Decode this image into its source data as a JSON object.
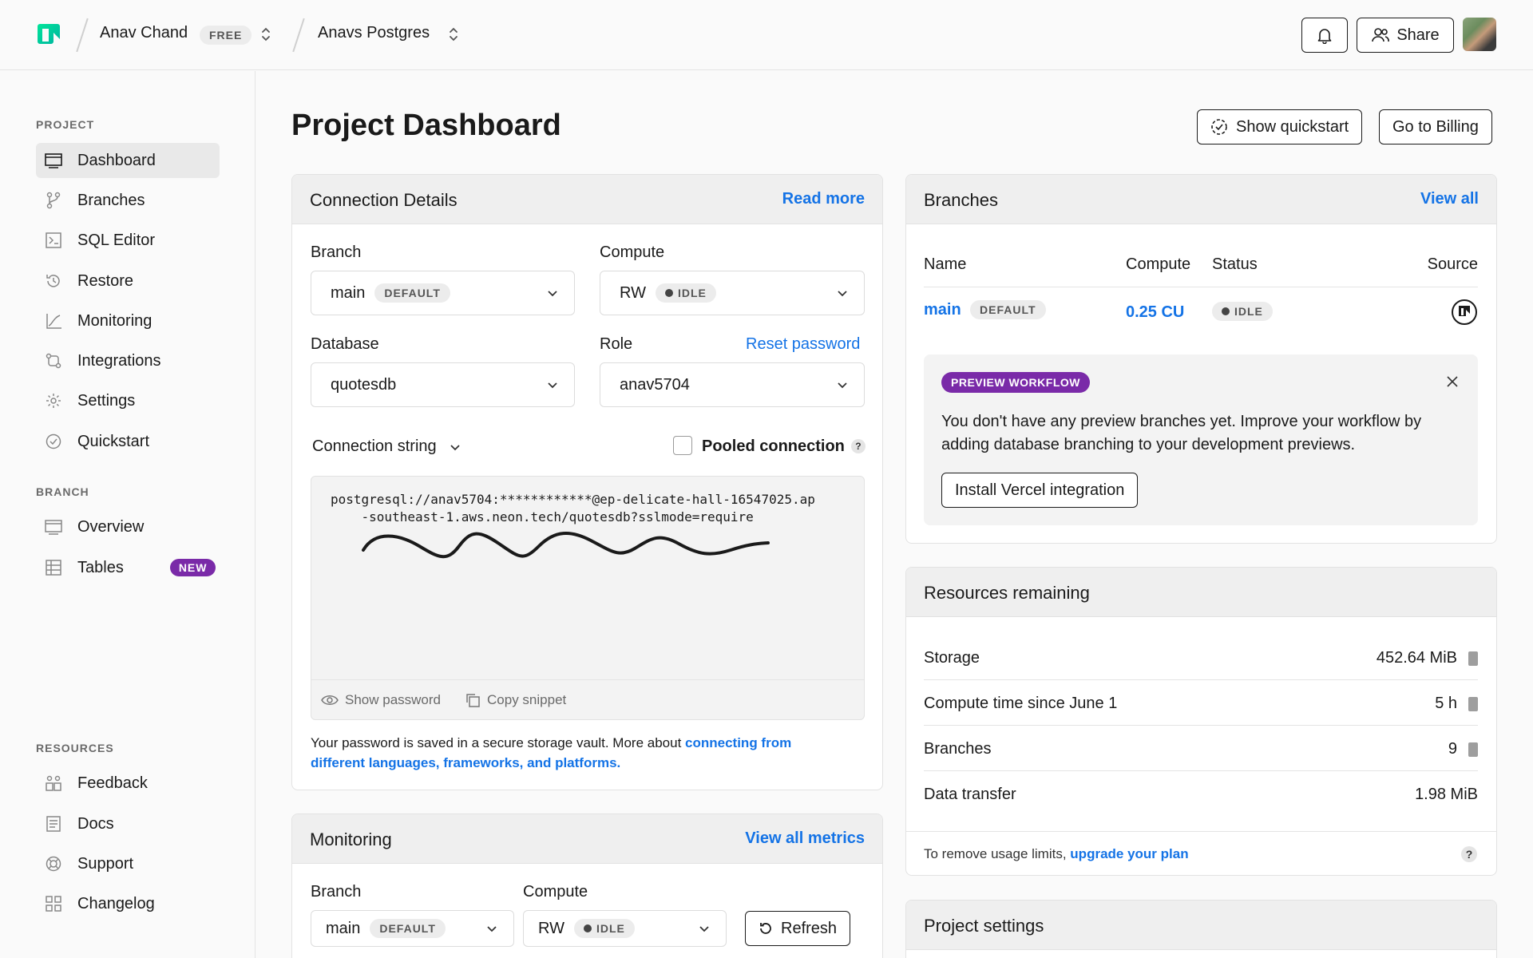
{
  "topbar": {
    "user_name": "Anav Chand",
    "plan_badge": "FREE",
    "project_name": "Anavs Postgres",
    "share_label": "Share"
  },
  "sidebar": {
    "project_label": "PROJECT",
    "project_items": [
      {
        "label": "Dashboard",
        "icon": "dashboard-icon"
      },
      {
        "label": "Branches",
        "icon": "branch-icon"
      },
      {
        "label": "SQL Editor",
        "icon": "sql-editor-icon"
      },
      {
        "label": "Restore",
        "icon": "restore-icon"
      },
      {
        "label": "Monitoring",
        "icon": "monitoring-icon"
      },
      {
        "label": "Integrations",
        "icon": "integrations-icon"
      },
      {
        "label": "Settings",
        "icon": "gear-icon"
      },
      {
        "label": "Quickstart",
        "icon": "check-circle-icon"
      }
    ],
    "branch_label": "BRANCH",
    "branch_items": [
      {
        "label": "Overview",
        "icon": "overview-icon"
      },
      {
        "label": "Tables",
        "icon": "table-icon",
        "badge": "NEW"
      }
    ],
    "resources_label": "RESOURCES",
    "resources_items": [
      {
        "label": "Feedback",
        "icon": "feedback-icon"
      },
      {
        "label": "Docs",
        "icon": "docs-icon"
      },
      {
        "label": "Support",
        "icon": "lifebuoy-icon"
      },
      {
        "label": "Changelog",
        "icon": "changelog-icon"
      }
    ]
  },
  "header": {
    "title": "Project Dashboard",
    "quickstart_label": "Show quickstart",
    "billing_label": "Go to Billing"
  },
  "connection": {
    "title": "Connection Details",
    "read_more": "Read more",
    "branch_label": "Branch",
    "branch_value": "main",
    "branch_tag": "DEFAULT",
    "compute_label": "Compute",
    "compute_value": "RW",
    "compute_tag": "IDLE",
    "database_label": "Database",
    "database_value": "quotesdb",
    "role_label": "Role",
    "reset_password": "Reset password",
    "role_value": "anav5704",
    "conn_string_label": "Connection string",
    "pooled_label": "Pooled connection",
    "pooled_help": "?",
    "code_line1": "postgresql://anav5704:************@ep-delicate-hall-16547025.ap",
    "code_line2": "    -southeast-1.aws.neon.tech/quotesdb?sslmode=require",
    "show_password": "Show password",
    "copy_snippet": "Copy snippet",
    "note_prefix": "Your password is saved in a secure storage vault. More about ",
    "note_link_1": "connecting from",
    "note_link_2": "different languages, frameworks, and platforms."
  },
  "monitoring": {
    "title": "Monitoring",
    "view_all": "View all metrics",
    "branch_label": "Branch",
    "branch_value": "main",
    "branch_tag": "DEFAULT",
    "compute_label": "Compute",
    "compute_value": "RW",
    "compute_tag": "IDLE",
    "refresh_label": "Refresh"
  },
  "branches": {
    "title": "Branches",
    "view_all": "View all",
    "columns": [
      "Name",
      "Compute",
      "Status",
      "Source"
    ],
    "rows": [
      {
        "name": "main",
        "tag": "DEFAULT",
        "compute": "0.25 CU",
        "status": "IDLE"
      }
    ],
    "preview": {
      "badge": "PREVIEW WORKFLOW",
      "text": "You don't have any preview branches yet. Improve your workflow by adding database branching to your development previews.",
      "button": "Install Vercel integration"
    }
  },
  "resources": {
    "title": "Resources remaining",
    "rows": [
      {
        "label": "Storage",
        "value": "452.64 MiB",
        "has_bar": true
      },
      {
        "label": "Compute time since June 1",
        "value": "5 h",
        "has_bar": true
      },
      {
        "label": "Branches",
        "value": "9",
        "has_bar": true
      },
      {
        "label": "Data transfer",
        "value": "1.98 MiB",
        "has_bar": false
      }
    ],
    "footer_prefix": "To remove usage limits, ",
    "footer_link": "upgrade your plan",
    "footer_help": "?"
  },
  "project_settings": {
    "title": "Project settings"
  },
  "colors": {
    "accent_link": "#1473e6",
    "badge_purple": "#7a2aa8",
    "logo_green": "#00e599"
  }
}
